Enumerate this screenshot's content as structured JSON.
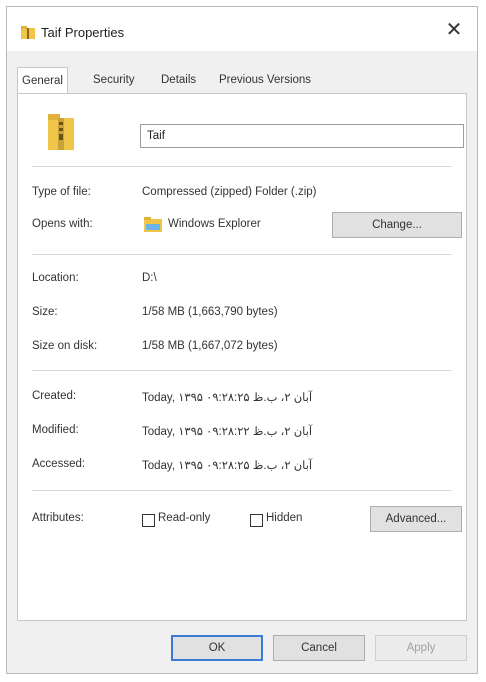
{
  "window": {
    "title": "Taif Properties",
    "close_glyph": "✕"
  },
  "tabs": [
    {
      "label": "General"
    },
    {
      "label": "Security"
    },
    {
      "label": "Details"
    },
    {
      "label": "Previous Versions"
    }
  ],
  "name_field": {
    "value": "Taif"
  },
  "type_of_file": {
    "label": "Type of file:",
    "value": "Compressed (zipped) Folder (.zip)"
  },
  "opens_with": {
    "label": "Opens with:",
    "value": "Windows Explorer",
    "button": "Change..."
  },
  "location": {
    "label": "Location:",
    "value": "D:\\"
  },
  "size": {
    "label": "Size:",
    "value": "1/58 MB (1,663,790 bytes)"
  },
  "size_on_disk": {
    "label": "Size on disk:",
    "value": "1/58 MB (1,667,072 bytes)"
  },
  "created": {
    "label": "Created:",
    "value": "Today, ۱۳۹۵ آبان ۲، ب.ظ ۰۹:۲۸:۲۵"
  },
  "modified": {
    "label": "Modified:",
    "value": "Today, ۱۳۹۵ آبان ۲، ب.ظ ۰۹:۲۸:۲۲"
  },
  "accessed": {
    "label": "Accessed:",
    "value": "Today, ۱۳۹۵ آبان ۲، ب.ظ ۰۹:۲۸:۲۵"
  },
  "attributes": {
    "label": "Attributes:",
    "readonly": "Read-only",
    "hidden": "Hidden",
    "advanced": "Advanced..."
  },
  "footer": {
    "ok": "OK",
    "cancel": "Cancel",
    "apply": "Apply"
  },
  "icons": {
    "title": "zip-folder-icon",
    "file": "zip-folder-icon",
    "opens_with": "explorer-folder-icon"
  },
  "colors": {
    "window_bg": "#f0f0f0",
    "panel_bg": "#ffffff",
    "folder_yellow": "#f0c64a",
    "accent_blue": "#3b7ad6"
  }
}
